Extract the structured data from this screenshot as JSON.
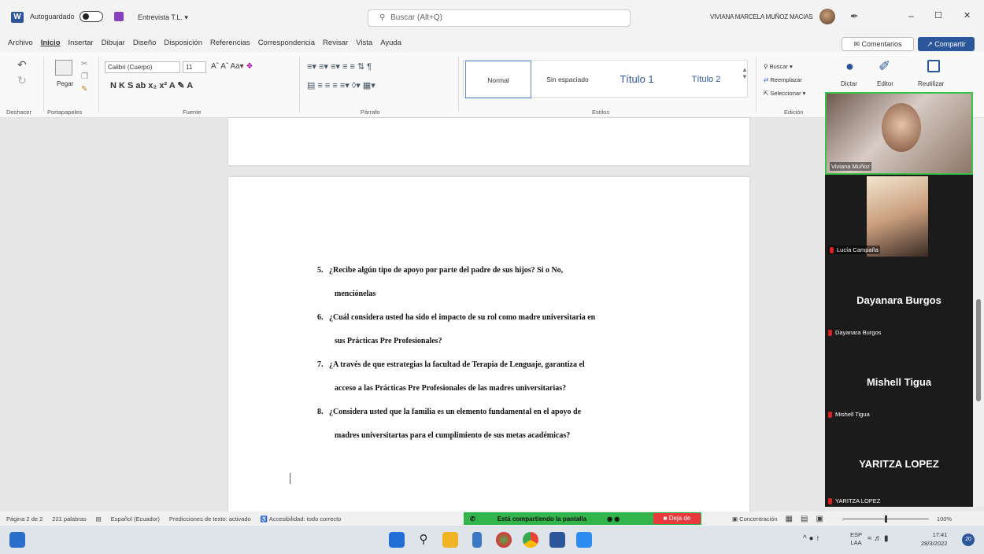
{
  "titlebar": {
    "autosave_label": "Autoguardado",
    "document_name": "Entrevista T.L. ▾",
    "search_placeholder": "Buscar (Alt+Q)",
    "user_name": "VIVIANA MARCELA MUÑOZ MACIAS",
    "min_glyph": "–",
    "max_glyph": "☐",
    "close_glyph": "✕"
  },
  "menu": {
    "items": [
      "Archivo",
      "Inicio",
      "Insertar",
      "Dibujar",
      "Diseño",
      "Disposición",
      "Referencias",
      "Correspondencia",
      "Revisar",
      "Vista",
      "Ayuda"
    ],
    "comentarios": "Comentarios",
    "compartir": "Compartir"
  },
  "ribbon": {
    "undo_label": "Deshacer",
    "clipboard_label": "Portapapeles",
    "paste_label": "Pegar",
    "font_name": "Calibri (Cuerpo)",
    "font_size": "11",
    "font_tools": "N  K  S  ab  x₂  x²  A  ✎  A",
    "font_group": "Fuente",
    "paragraph_group": "Párrafo",
    "styles": [
      "Normal",
      "Sin espaciado",
      "Título 1",
      "Título 2"
    ],
    "styles_group": "Estilos",
    "buscar": "Buscar",
    "reemplazar": "Reemplazar",
    "seleccionar": "Seleccionar",
    "edicion_group": "Edición",
    "dictar": "Dictar",
    "editor": "Editor",
    "reutilizar": "Reutilizar"
  },
  "document": {
    "questions": [
      {
        "num": "5.",
        "line1": "¿Recibe algún tipo de apoyo por parte del padre de sus hijos? Si o No,",
        "line2": "menciónelas"
      },
      {
        "num": "6.",
        "line1": "¿Cuál considera usted ha sido el impacto de su rol como madre universitaria en",
        "line2": "sus Prácticas Pre Profesionales?"
      },
      {
        "num": "7.",
        "line1": "¿A través de que estrategias la facultad de Terapia de Lenguaje, garantiza el",
        "line2": "acceso a las Prácticas Pre Profesionales de las madres universitarias?"
      },
      {
        "num": "8.",
        "line1": "¿Considera usted que la familia es un elemento fundamental en el apoyo de",
        "line2": "madres universitartas para el cumplimiento de sus metas académicas?"
      }
    ]
  },
  "participants": [
    {
      "name": "Viviana Muñoz"
    },
    {
      "name": "Lucía Campaña"
    },
    {
      "name": "Dayanara Burgos",
      "display": "Dayanara Burgos"
    },
    {
      "name": "Mishell Tigua",
      "display": "Mishell Tigua"
    },
    {
      "name": "YARITZA LOPEZ",
      "display": "YARITZA LOPEZ"
    }
  ],
  "statusbar": {
    "page": "Página 2 de 2",
    "words": "221 palabras",
    "language": "Español (Ecuador)",
    "predictions": "Predicciones de texto: activado",
    "accessibility": "Accesibilidad: todo correcto",
    "sharing": "Está compartiendo la pantalla",
    "stop_share": "Deja de",
    "focus": "Concentración",
    "zoom": "100%"
  },
  "taskbar": {
    "lang_top": "ESP",
    "lang_bottom": "LAA",
    "time": "17:41",
    "date": "28/3/2022",
    "notif_count": "20"
  },
  "colors": {
    "word_blue": "#2b579a",
    "share_green": "#33b44a",
    "stop_red": "#e8393c"
  }
}
